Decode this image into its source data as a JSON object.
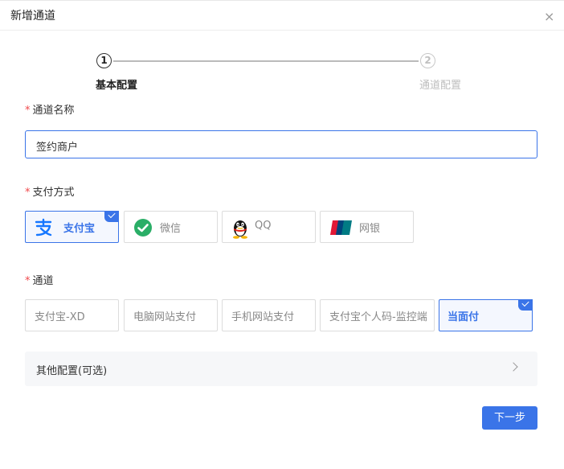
{
  "dialog": {
    "title": "新增通道",
    "close_glyph": "×"
  },
  "steps": [
    {
      "number": "1",
      "label": "基本配置"
    },
    {
      "number": "2",
      "label": "通道配置"
    }
  ],
  "form": {
    "channel_name": {
      "label": "通道名称",
      "value": "签约商户"
    },
    "payment_method": {
      "label": "支付方式"
    },
    "channel": {
      "label": "通道"
    },
    "required_mark": "*"
  },
  "payment_methods": [
    {
      "label": "支付宝",
      "icon": "alipay-icon",
      "selected": true
    },
    {
      "label": "微信",
      "icon": "wechat-icon",
      "selected": false
    },
    {
      "label": "QQ",
      "icon": "qq-icon",
      "selected": false
    },
    {
      "label": "网银",
      "icon": "unionpay-icon",
      "selected": false
    }
  ],
  "channels": [
    {
      "label": "支付宝-XD",
      "selected": false
    },
    {
      "label": "电脑网站支付",
      "selected": false
    },
    {
      "label": "手机网站支付",
      "selected": false
    },
    {
      "label": "支付宝个人码-监控端",
      "selected": false
    },
    {
      "label": "当面付",
      "selected": true
    }
  ],
  "other_config": {
    "label": "其他配置(可选)"
  },
  "next_button": {
    "label": "下一步"
  },
  "colors": {
    "accent": "#3a74e8",
    "required": "#f0484b",
    "alipay": "#1677ff",
    "wechat": "#2aae67",
    "unionpay_red": "#e21836"
  }
}
